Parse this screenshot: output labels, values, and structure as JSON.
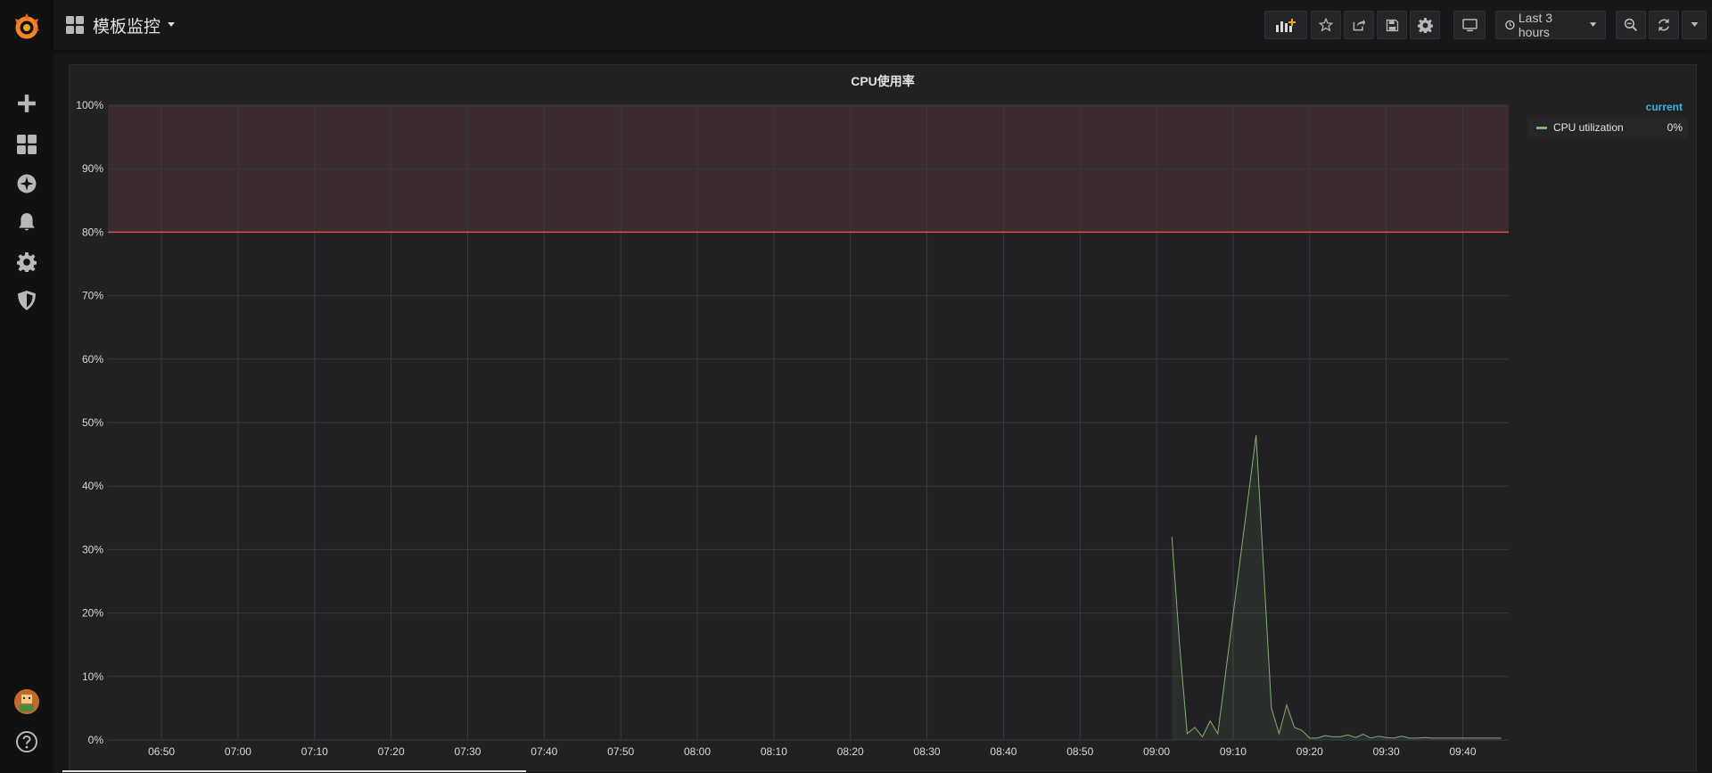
{
  "app": {
    "dashboard_title": "模板监控",
    "time_range_label": "Last 3 hours"
  },
  "sidemenu": {
    "items": [
      "create",
      "dashboards",
      "explore",
      "alerting",
      "configuration",
      "server-admin"
    ]
  },
  "toolbar": {
    "buttons": [
      "add-panel",
      "star",
      "share",
      "save",
      "settings",
      "cycle-view-mode",
      "time-picker",
      "zoom-out",
      "refresh",
      "refresh-interval"
    ]
  },
  "colors": {
    "series": "#7eb26d",
    "threshold_line": "#e24d42",
    "threshold_fill": "#3c2b2f",
    "legend_header": "#33b5e5"
  },
  "panel": {
    "title": "CPU使用率",
    "legend": {
      "header": "current",
      "items": [
        {
          "name": "CPU utilization",
          "value": "0%"
        }
      ]
    }
  },
  "chart_data": {
    "type": "area",
    "title": "CPU使用率",
    "y_ticks": [
      "0%",
      "10%",
      "20%",
      "30%",
      "40%",
      "50%",
      "60%",
      "70%",
      "80%",
      "90%",
      "100%"
    ],
    "ylim": [
      0,
      100
    ],
    "x_ticks": [
      "06:50",
      "07:00",
      "07:10",
      "07:20",
      "07:30",
      "07:40",
      "07:50",
      "08:00",
      "08:10",
      "08:20",
      "08:30",
      "08:40",
      "08:50",
      "09:00",
      "09:10",
      "09:20",
      "09:30",
      "09:40"
    ],
    "threshold": {
      "value": 80,
      "fill": "above"
    },
    "series": [
      {
        "name": "CPU utilization",
        "points": [
          [
            "09:02",
            32
          ],
          [
            "09:03",
            15
          ],
          [
            "09:04",
            1
          ],
          [
            "09:05",
            2
          ],
          [
            "09:06",
            0.5
          ],
          [
            "09:07",
            3
          ],
          [
            "09:08",
            1
          ],
          [
            "09:13",
            48
          ],
          [
            "09:15",
            5
          ],
          [
            "09:16",
            1
          ],
          [
            "09:17",
            5.5
          ],
          [
            "09:18",
            2
          ],
          [
            "09:19",
            1.5
          ],
          [
            "09:20",
            0.3
          ],
          [
            "09:21",
            0.3
          ],
          [
            "09:22",
            0.7
          ],
          [
            "09:23",
            0.5
          ],
          [
            "09:24",
            0.5
          ],
          [
            "09:25",
            0.8
          ],
          [
            "09:26",
            0.4
          ],
          [
            "09:27",
            0.9
          ],
          [
            "09:28",
            0.3
          ],
          [
            "09:29",
            0.6
          ],
          [
            "09:30",
            0.4
          ],
          [
            "09:31",
            0.3
          ],
          [
            "09:32",
            0.6
          ],
          [
            "09:33",
            0.3
          ],
          [
            "09:34",
            0.3
          ],
          [
            "09:35",
            0.4
          ],
          [
            "09:36",
            0.3
          ],
          [
            "09:37",
            0.3
          ],
          [
            "09:38",
            0.3
          ],
          [
            "09:39",
            0.3
          ],
          [
            "09:40",
            0.3
          ],
          [
            "09:41",
            0.3
          ],
          [
            "09:42",
            0.3
          ],
          [
            "09:43",
            0.3
          ],
          [
            "09:44",
            0.3
          ],
          [
            "09:45",
            0.3
          ]
        ]
      }
    ],
    "grid": true,
    "legend_position": "right"
  }
}
